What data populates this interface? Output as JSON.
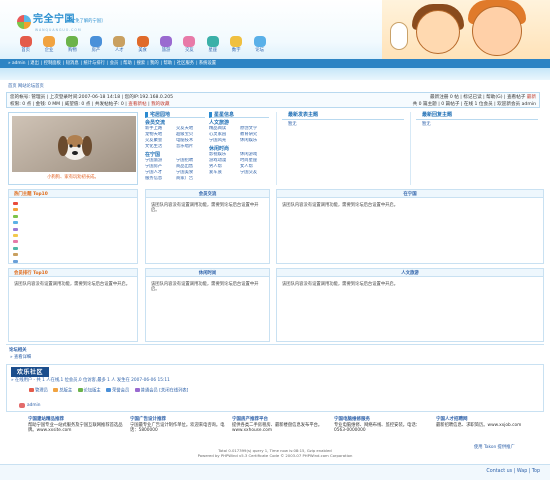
{
  "header": {
    "logo_name": "完全宁国",
    "logo_slogan": "[完全免了解的宁国]",
    "logo_sub": "WANQUANGUO.COM"
  },
  "nav": [
    {
      "label": "首页",
      "color": "#e45b4a"
    },
    {
      "label": "企业",
      "color": "#f1a340"
    },
    {
      "label": "购物",
      "color": "#6cb34a"
    },
    {
      "label": "房产",
      "color": "#4a90d9"
    },
    {
      "label": "人才",
      "color": "#c9a060"
    },
    {
      "label": "美食",
      "color": "#e06a2a"
    },
    {
      "label": "旅游",
      "color": "#9a6ad0"
    },
    {
      "label": "交友",
      "color": "#e87aa8"
    },
    {
      "label": "星座",
      "color": "#3bb0a8"
    },
    {
      "label": "数字",
      "color": "#f0c040"
    },
    {
      "label": "论坛",
      "color": "#5ab0e8"
    }
  ],
  "menubar": [
    "admin",
    "退出",
    "控制面板",
    "短消息",
    "统计与排行",
    "会员",
    "帮助",
    "搜索",
    "我的",
    "帮助",
    "社区服务",
    "系统设置"
  ],
  "breadcrumb": "首页 网站论坛首页",
  "info": {
    "line1": "您的帐号: 管理员 | 上次登录时间:2007-06-18 14:18 | 您的IP:192.168.0.205",
    "line2_a": "权限: 0 点 | 金钱: 0 MM | 威望值: 0 点 | 共发帖帖子: 0 | ",
    "line2_link1": "查看新帖",
    "line2_sep": " | ",
    "line2_link2": "我的收藏",
    "r1": "最新注册 0 帖 | 标记已读 | 帮助(G) | 查看帖子 ",
    "r2": "共 0 篇主题 | 0 篇帖子 | 在线 1 位会员 | 欢迎新会员 admin",
    "r1_new": "最新"
  },
  "dog_caption": "小狗狗、家有玩劝初长成。",
  "categories": [
    {
      "title": "会员交流",
      "items": [
        "新手上路",
        "交友天地",
        "宠物天地",
        "超级宝贝",
        "交友聚会",
        "电脑技术",
        "文化生活",
        "音乐唱片"
      ]
    },
    {
      "title": "人文旅游",
      "items": [
        "精品阅读",
        "原创文学",
        "心灵家园",
        "教育研究",
        "宁国风光",
        "休闲娱乐"
      ]
    },
    {
      "title": "在宁国",
      "items": [
        "宁国旅游",
        "宁国招聘",
        "宁国房产",
        "商品出售",
        "宁国人才",
        "宁国美食",
        "服务信息",
        "商家广告"
      ]
    },
    {
      "title": "休闲时尚",
      "items": [
        "影视娱乐",
        "休闲游戏",
        "游戏动漫",
        "时尚星座",
        "男人帮",
        "女人帮",
        "爱车族",
        "宁国交友"
      ]
    }
  ],
  "cat_tabs": {
    "a": "宅居园地",
    "b": "星星信息"
  },
  "new_posts": {
    "title": "最新发表主题",
    "line": "暂无"
  },
  "new_replies": {
    "title": "最新回复主题",
    "line": "暂无"
  },
  "panels": {
    "hot_title": "热门主题 Top10",
    "mid1_title": "会员交流",
    "mid1_text": "该团队内容没有设置调用功能，需要到论坛后台设置中开启。",
    "mid2_title": "在宁国",
    "mid2_text": "该团队内容没有设置调用功能，需要到论坛后台设置中开启。",
    "rank_title": "会员排行 Top10",
    "rank_text": "该团队内容没有设置调用功能，需要到论坛后台设置中开启。",
    "mid3_title": "休闲时尚",
    "mid3_text": "该团队内容没有设置调用功能，需要到论坛后台设置中开启。",
    "mid4_title": "人文旅游",
    "mid4_text": "该团队内容没有设置调用功能，需要到论坛后台设置中开启。"
  },
  "rank_colors": [
    "#e94b3c",
    "#f2a23a",
    "#7cc44a",
    "#5bb1e6",
    "#9b7ad6",
    "#f2c94c",
    "#e77aa8",
    "#4fb7a6",
    "#c9a060",
    "#6aa0d8"
  ],
  "friend": {
    "header": "论坛相关",
    "readmore": "» 查看详细",
    "box_title": "欢乐社区",
    "online_info": "» 在线用户 - 共 1 人在线,1 位会员,0 位访客,最多 1 人 发生在 2007-06-06 15:11",
    "legend": [
      {
        "label": "管理员",
        "color": "#e45b4a"
      },
      {
        "label": "总版主",
        "color": "#f1a340"
      },
      {
        "label": "论坛版主",
        "color": "#6cb34a"
      },
      {
        "label": "荣誉会员",
        "color": "#4a90d9"
      },
      {
        "label": "普通会员",
        "color": "#9a6ad0"
      },
      {
        "label": "[关闭在线列表]",
        "color": ""
      }
    ],
    "admin": "admin"
  },
  "ads": [
    {
      "title": "宁国建站精品推荐",
      "text": "帮助宁国专业一站式服务及宁国互联网推荐首选品牌。www.xxsite.com"
    },
    {
      "title": "宁国广告设计推荐",
      "text": "宁国最专业广告设计制作单位。欢迎来电咨询。电话：5800000"
    },
    {
      "title": "宁国房产推荐平台",
      "text": "提供各类二手房租房、最新楼盘信息发布平台。www.xxhouse.com"
    },
    {
      "title": "宁国电脑维修服务",
      "text": "专业电脑维修、网络布线、监控安装。电话：0563-0000000"
    },
    {
      "title": "宁国人才招聘网",
      "text": "最新招聘信息、求职简历。www.xxjob.com"
    }
  ],
  "more_ads": "使用 Takon 提供推广",
  "footer": {
    "l1": "Total 0.017399(s) query 1, Time now is:08:15, Gzip enabled",
    "l2": "Powered by PHPWind v5.3 Certificate Code © 2003-07 PHPWind.com Corporation"
  },
  "bottom_links": "Contact us | Wap | Top"
}
